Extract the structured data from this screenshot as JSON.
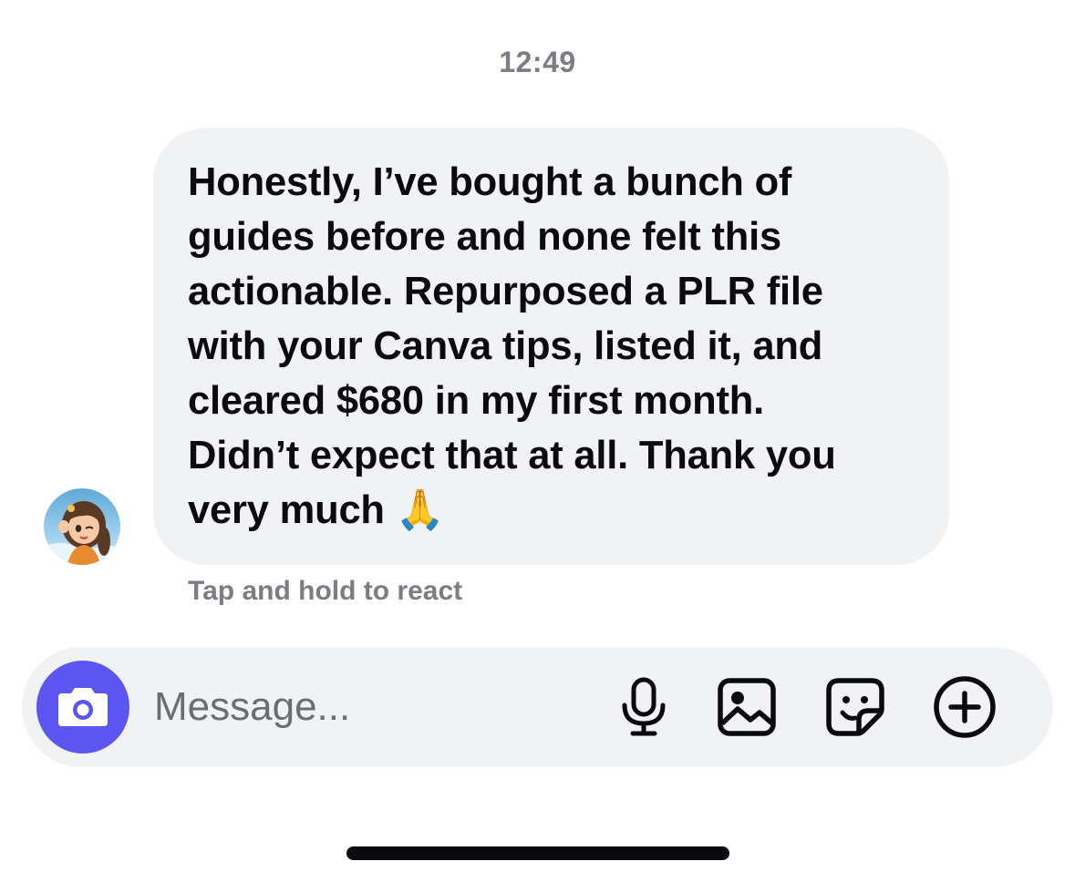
{
  "timestamp": "12:49",
  "message": {
    "text": "Honestly, I’ve bought a bunch of\nguides before and none felt this\nactionable. Repurposed a PLR file\nwith your Canva tips, listed it, and\ncleared $680 in my first month.\nDidn’t expect that at all. Thank you\nvery much 🙏",
    "react_hint": "Tap and hold to react"
  },
  "composer": {
    "placeholder": "Message..."
  },
  "icons": {
    "camera": "camera-icon",
    "microphone": "microphone-icon",
    "gallery": "image-icon",
    "sticker": "sticker-icon",
    "more": "plus-circle-icon"
  },
  "colors": {
    "accent": "#5b55f2",
    "bubble": "#f1f2f4",
    "muted_text": "#7b7d83"
  }
}
